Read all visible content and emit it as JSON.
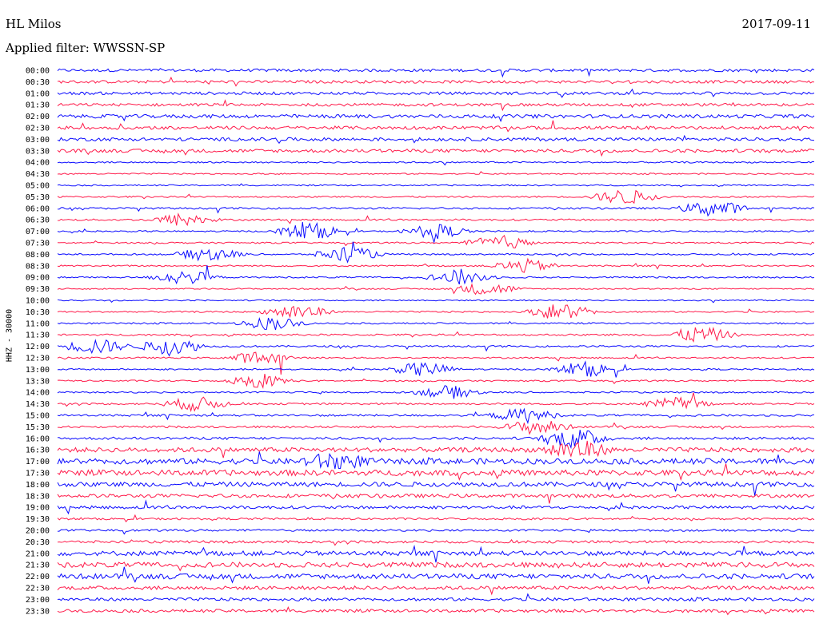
{
  "header": {
    "station": "HL Milos",
    "date": "2017-09-11",
    "filter_label": "Applied filter:",
    "filter_name": "WWSSN-SP"
  },
  "axis": {
    "component": "HHZ - 30000"
  },
  "colors": {
    "trace_a": "#0a0aff",
    "trace_b": "#ff1a4a",
    "text": "#000000",
    "background": "#ffffff"
  },
  "chart_data": {
    "type": "line",
    "subtype": "helicorder",
    "title": "HL Milos",
    "date": "2017-09-11",
    "filter": "WWSSN-SP",
    "ylabel": "HHZ - 30000",
    "line_duration_minutes": 30,
    "color_cycle": [
      "#0a0aff",
      "#ff1a4a"
    ],
    "grid": false,
    "row_labels": [
      "00:00",
      "00:30",
      "01:00",
      "01:30",
      "02:00",
      "02:30",
      "03:00",
      "03:30",
      "04:00",
      "04:30",
      "05:00",
      "05:30",
      "06:00",
      "06:30",
      "07:00",
      "07:30",
      "08:00",
      "08:30",
      "09:00",
      "09:30",
      "10:00",
      "10:30",
      "11:00",
      "11:30",
      "12:00",
      "12:30",
      "13:00",
      "13:30",
      "14:00",
      "14:30",
      "15:00",
      "15:30",
      "16:00",
      "16:30",
      "17:00",
      "17:30",
      "18:00",
      "18:30",
      "19:00",
      "19:30",
      "20:00",
      "20:30",
      "21:00",
      "21:30",
      "22:00",
      "22:30",
      "23:00",
      "23:30"
    ],
    "rows_noise_level": [
      0.55,
      0.55,
      0.55,
      0.55,
      0.7,
      0.65,
      0.65,
      0.65,
      0.3,
      0.25,
      0.25,
      0.3,
      0.35,
      0.35,
      0.3,
      0.3,
      0.3,
      0.3,
      0.3,
      0.25,
      0.25,
      0.3,
      0.3,
      0.35,
      0.35,
      0.3,
      0.3,
      0.3,
      0.3,
      0.35,
      0.4,
      0.4,
      0.5,
      0.9,
      1.1,
      1.1,
      0.9,
      0.7,
      0.6,
      0.4,
      0.4,
      0.5,
      0.9,
      1.0,
      1.0,
      0.7,
      0.6,
      0.6
    ],
    "events": [
      {
        "row": 11,
        "minute": 22.5,
        "amp": 1.4
      },
      {
        "row": 12,
        "minute": 26.0,
        "amp": 1.5
      },
      {
        "row": 13,
        "minute": 5.0,
        "amp": 1.2
      },
      {
        "row": 14,
        "minute": 10.0,
        "amp": 1.6
      },
      {
        "row": 14,
        "minute": 15.0,
        "amp": 1.3
      },
      {
        "row": 15,
        "minute": 17.5,
        "amp": 1.4
      },
      {
        "row": 16,
        "minute": 6.0,
        "amp": 1.3
      },
      {
        "row": 16,
        "minute": 11.5,
        "amp": 1.5
      },
      {
        "row": 17,
        "minute": 18.5,
        "amp": 1.2
      },
      {
        "row": 18,
        "minute": 5.0,
        "amp": 1.3
      },
      {
        "row": 18,
        "minute": 16.0,
        "amp": 1.4
      },
      {
        "row": 19,
        "minute": 17.0,
        "amp": 1.2
      },
      {
        "row": 21,
        "minute": 9.5,
        "amp": 1.5
      },
      {
        "row": 21,
        "minute": 20.0,
        "amp": 1.6
      },
      {
        "row": 22,
        "minute": 8.5,
        "amp": 1.2
      },
      {
        "row": 23,
        "minute": 25.5,
        "amp": 1.5
      },
      {
        "row": 24,
        "minute": 1.5,
        "amp": 1.4
      },
      {
        "row": 24,
        "minute": 4.5,
        "amp": 1.6
      },
      {
        "row": 25,
        "minute": 8.0,
        "amp": 1.2
      },
      {
        "row": 26,
        "minute": 14.5,
        "amp": 1.3
      },
      {
        "row": 26,
        "minute": 21.0,
        "amp": 1.3
      },
      {
        "row": 27,
        "minute": 8.0,
        "amp": 1.2
      },
      {
        "row": 28,
        "minute": 15.5,
        "amp": 1.2
      },
      {
        "row": 29,
        "minute": 5.5,
        "amp": 1.3
      },
      {
        "row": 29,
        "minute": 24.5,
        "amp": 1.2
      },
      {
        "row": 30,
        "minute": 18.5,
        "amp": 1.3
      },
      {
        "row": 31,
        "minute": 19.0,
        "amp": 1.4
      },
      {
        "row": 32,
        "minute": 20.5,
        "amp": 1.8
      },
      {
        "row": 33,
        "minute": 20.5,
        "amp": 1.8
      },
      {
        "row": 34,
        "minute": 11.0,
        "amp": 1.4
      }
    ]
  }
}
